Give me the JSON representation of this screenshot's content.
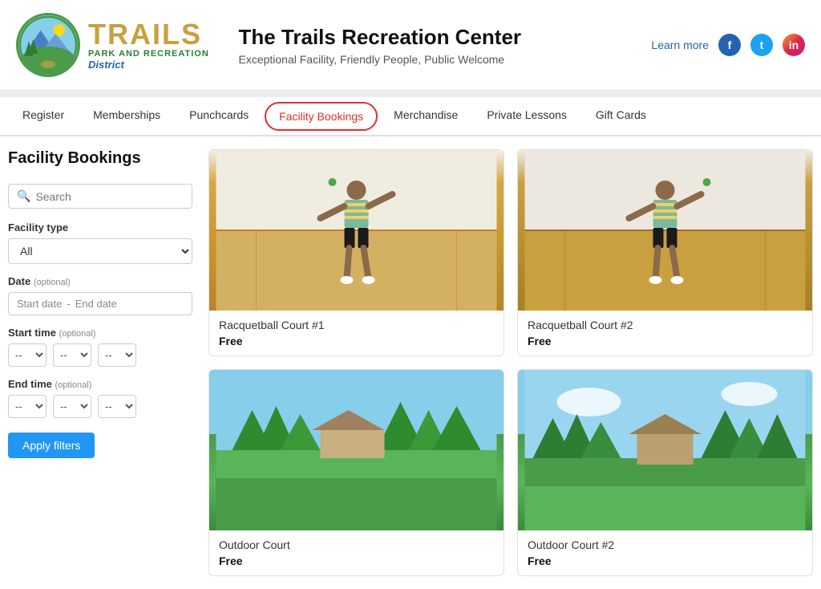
{
  "header": {
    "title": "The Trails Recreation Center",
    "subtitle": "Exceptional Facility, Friendly People, Public Welcome",
    "learn_more": "Learn more",
    "logo_name": "Trails Park and Recreation District",
    "logo_trails": "TRAILS",
    "logo_sub": "PARK AND RECREATION",
    "logo_district": "District"
  },
  "nav": {
    "items": [
      {
        "label": "Register",
        "active": false
      },
      {
        "label": "Memberships",
        "active": false
      },
      {
        "label": "Punchcards",
        "active": false
      },
      {
        "label": "Facility Bookings",
        "active": true
      },
      {
        "label": "Merchandise",
        "active": false
      },
      {
        "label": "Private Lessons",
        "active": false
      },
      {
        "label": "Gift Cards",
        "active": false
      }
    ]
  },
  "page": {
    "title": "Facility Bookings"
  },
  "sidebar": {
    "search_placeholder": "Search",
    "facility_type_label": "Facility type",
    "facility_type_options": [
      "All"
    ],
    "facility_type_value": "All",
    "date_label": "Date",
    "date_optional": "(optional)",
    "start_date_placeholder": "Start date",
    "end_date_placeholder": "End date",
    "start_time_label": "Start time",
    "start_time_optional": "(optional)",
    "end_time_label": "End time",
    "end_time_optional": "(optional)",
    "time_options": [
      "--"
    ],
    "apply_button": "Apply filters"
  },
  "cards": [
    {
      "id": 1,
      "name": "Racquetball Court #1",
      "price": "Free",
      "type": "racquetball"
    },
    {
      "id": 2,
      "name": "Racquetball Court #2",
      "price": "Free",
      "type": "racquetball2"
    },
    {
      "id": 3,
      "name": "Outdoor Court",
      "price": "Free",
      "type": "outdoor"
    },
    {
      "id": 4,
      "name": "Outdoor Court #2",
      "price": "Free",
      "type": "outdoor2"
    }
  ],
  "social": {
    "facebook_label": "f",
    "twitter_label": "t",
    "instagram_label": "in"
  }
}
